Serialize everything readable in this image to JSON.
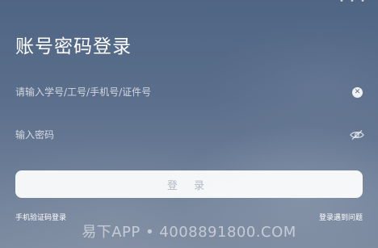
{
  "header": {
    "status_glyph": "• • •"
  },
  "login": {
    "title": "账号密码登录",
    "account_placeholder": "请输入学号/工号/手机号/证件号",
    "account_value": "",
    "password_placeholder": "输入密码",
    "password_value": "",
    "clear_glyph": "✕",
    "submit_label": "登 录",
    "sms_login_label": "手机验证码登录",
    "problem_label": "登录遇到问题"
  },
  "watermark": {
    "text": "易下APP • 4008891800.COM"
  },
  "icons": {
    "clear": "clear-icon",
    "password_visibility": "eye-off-icon"
  },
  "colors": {
    "background": "#5b6f8c",
    "button_bg": "#f4f5f7",
    "button_text": "#b4bac4",
    "text": "#ffffff"
  }
}
